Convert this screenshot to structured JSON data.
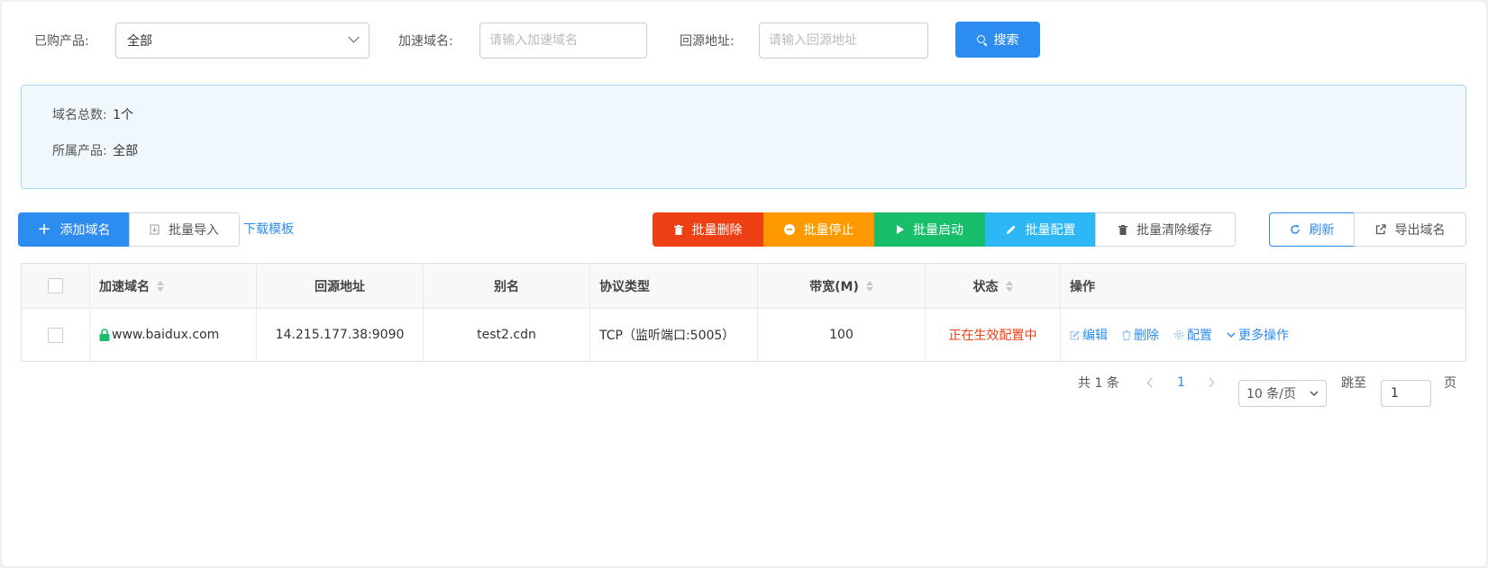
{
  "filters": {
    "product_label": "已购产品:",
    "product_value": "全部",
    "domain_label": "加速域名:",
    "domain_placeholder": "请输入加速域名",
    "origin_label": "回源地址:",
    "origin_placeholder": "请输入回源地址",
    "search_button": "搜索"
  },
  "summary": {
    "total_label": "域名总数:",
    "total_value": "1个",
    "product_label": "所属产品:",
    "product_value": "全部"
  },
  "toolbar": {
    "add_domain": "添加域名",
    "batch_import": "批量导入",
    "download_template": "下载模板",
    "batch_delete": "批量删除",
    "batch_stop": "批量停止",
    "batch_start": "批量启动",
    "batch_config": "批量配置",
    "batch_clear_cache": "批量清除缓存",
    "refresh": "刷新",
    "export_domains": "导出域名"
  },
  "table": {
    "headers": [
      "加速域名",
      "回源地址",
      "别名",
      "协议类型",
      "带宽(M)",
      "状态",
      "操作"
    ],
    "rows": [
      {
        "domain": "www.baidux.com",
        "origin": "14.215.177.38:9090",
        "alias": "test2.cdn",
        "protocol": "TCP（监听端口:5005）",
        "bandwidth": "100",
        "status": "正在生效配置中"
      }
    ],
    "actions": {
      "edit": "编辑",
      "delete": "删除",
      "config": "配置",
      "more": "更多操作"
    }
  },
  "pagination": {
    "total": "共 1 条",
    "current_page": "1",
    "page_size": "10 条/页",
    "jump_label": "跳至",
    "jump_value": "1",
    "page_suffix": "页"
  },
  "colors": {
    "primary": "#2d8cf0",
    "danger": "#ed4014",
    "warning": "#ff9900",
    "success": "#19be6b",
    "info": "#2db7f5",
    "status_text": "#ed4014"
  }
}
